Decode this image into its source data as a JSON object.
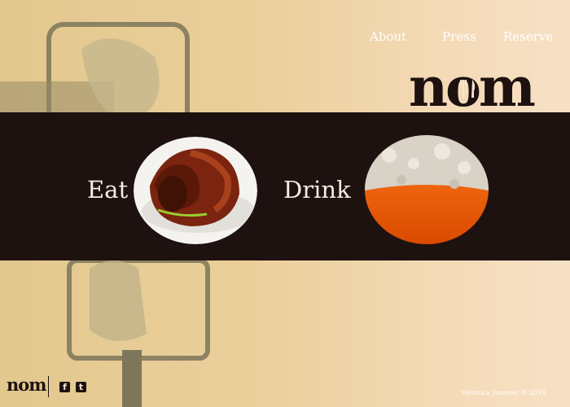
{
  "nav": {
    "items": [
      "About",
      "Press",
      "Reserve"
    ]
  },
  "brand": {
    "logo": "nom"
  },
  "menu": {
    "eat_label": "Eat",
    "drink_label": "Drink"
  },
  "footer": {
    "credit": "Veronica Jimenez © 2013"
  },
  "icons": {
    "facebook": "facebook-icon",
    "twitter": "twitter-icon",
    "fork": "fork-icon",
    "knife": "knife-icon"
  },
  "colors": {
    "band": "#1e1211",
    "background_left": "#e2c88e",
    "background_right": "#f7e1c6",
    "label_text": "#f6ecdf"
  }
}
